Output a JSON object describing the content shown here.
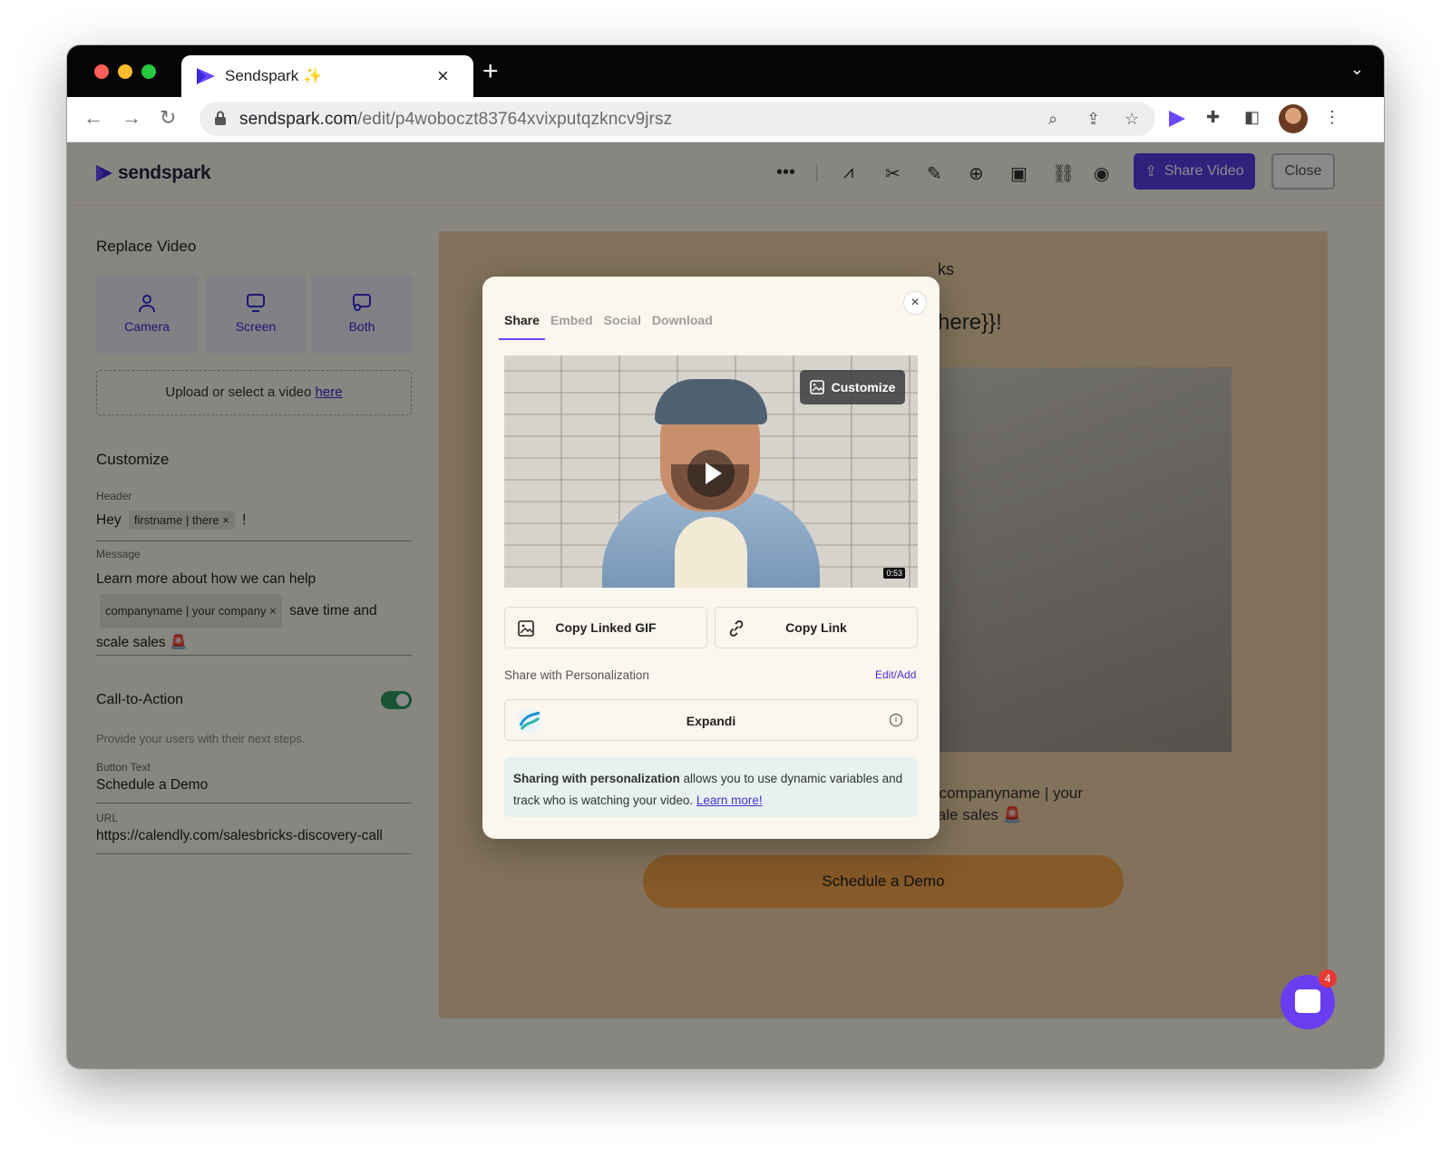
{
  "browser": {
    "tab_title": "Sendspark ✨",
    "url_host": "sendspark.com",
    "url_path": "/edit/p4woboczt83764xvixputqzkncv9jrsz"
  },
  "app": {
    "brand": "sendspark",
    "share_button": "Share Video",
    "close_button": "Close"
  },
  "left_panel": {
    "replace_title": "Replace Video",
    "sources": [
      "Camera",
      "Screen",
      "Both"
    ],
    "upload_text": "Upload or select a video",
    "upload_link": "here",
    "customize_title": "Customize",
    "header_label": "Header",
    "header_prefix": "Hey",
    "header_chip": "firstname | there",
    "header_suffix": "!",
    "message_label": "Message",
    "message_line1": "Learn more about how we can help",
    "message_chip": "companyname | your company",
    "message_after_chip": "save time and",
    "message_line3": "scale sales 🚨",
    "cta_title": "Call-to-Action",
    "cta_hint": "Provide your users with their next steps.",
    "button_text_label": "Button Text",
    "button_text_value": "Schedule a Demo",
    "url_label": "URL",
    "url_value": "https://calendly.com/salesbricks-discovery-call"
  },
  "preview": {
    "header_top": "ks",
    "header_tail": "here}}!",
    "message": "Learn more about how we can help {{companyname | your company}} save time and scale sales 🚨",
    "cta": "Schedule a Demo"
  },
  "chat": {
    "badge": "4"
  },
  "modal": {
    "tabs": [
      "Share",
      "Embed",
      "Social",
      "Download"
    ],
    "active_tab": "Share",
    "customize": "Customize",
    "duration": "0:53",
    "copy_gif": "Copy Linked GIF",
    "copy_link": "Copy Link",
    "personalization_label": "Share with Personalization",
    "edit_add": "Edit/Add",
    "integration_name": "Expandi",
    "note_bold": "Sharing with personalization",
    "note_text": "allows you to use dynamic variables and track who is watching your video.",
    "note_link": "Learn more!"
  },
  "colors": {
    "brand_purple": "#5b3de8",
    "preview_bg": "#f1d2a9",
    "cta_orange": "#f5a54a",
    "toggle_green": "#2f9a5e"
  }
}
